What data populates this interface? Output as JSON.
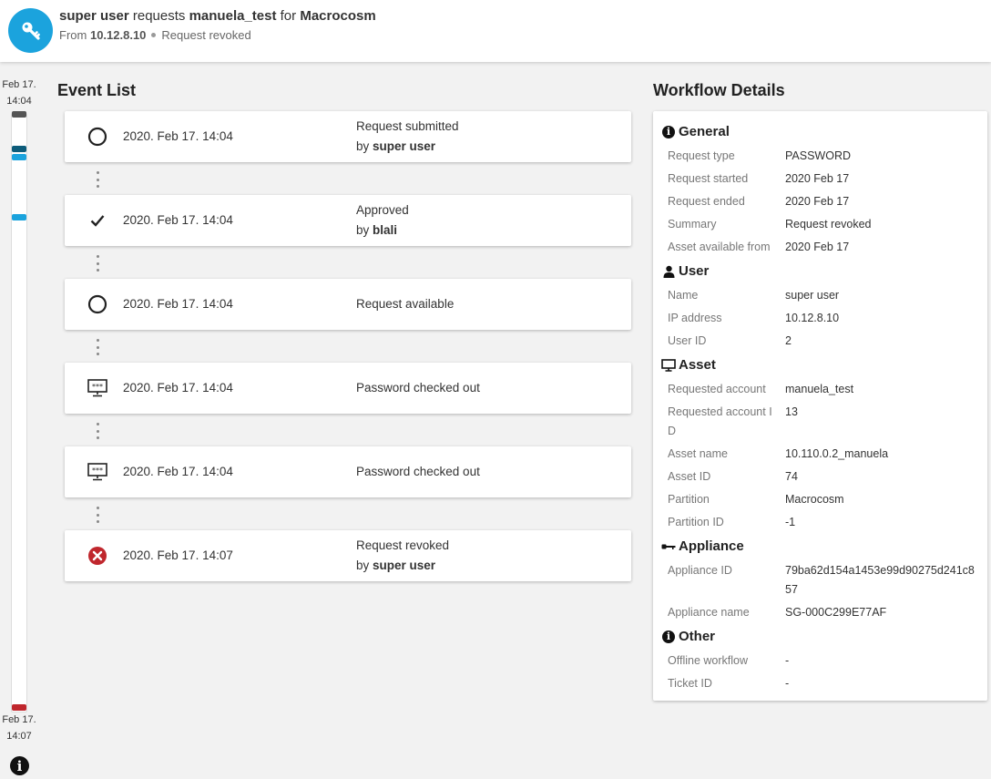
{
  "header": {
    "requester": "super user",
    "requests_word": "requests",
    "account": "manuela_test",
    "for_word": "for",
    "partition": "Macrocosm",
    "from_word": "From",
    "ip": "10.12.8.10",
    "status": "Request revoked",
    "accent_color": "#1ba3dd"
  },
  "timeline": {
    "start_date": "Feb 17.",
    "start_time": "14:04",
    "end_date": "Feb 17.",
    "end_time": "14:07",
    "marker_colors": [
      "#555555",
      "#0d5c7a",
      "#1ba3dd",
      "#1ba3dd",
      "#c0272d"
    ]
  },
  "event_list": {
    "title": "Event List",
    "events": [
      {
        "icon": "circle-icon",
        "time": "2020. Feb 17. 14:04",
        "text": "Request submitted",
        "by": "by",
        "actor": "super user"
      },
      {
        "icon": "checkmark-icon",
        "time": "2020. Feb 17. 14:04",
        "text": "Approved",
        "by": "by",
        "actor": "blali"
      },
      {
        "icon": "circle-icon",
        "time": "2020. Feb 17. 14:04",
        "text": "Request available",
        "by": "",
        "actor": ""
      },
      {
        "icon": "password-monitor-icon",
        "time": "2020. Feb 17. 14:04",
        "text": "Password checked out",
        "by": "",
        "actor": ""
      },
      {
        "icon": "password-monitor-icon",
        "time": "2020. Feb 17. 14:04",
        "text": "Password checked out",
        "by": "",
        "actor": ""
      },
      {
        "icon": "revoked-x-icon",
        "time": "2020. Feb 17. 14:07",
        "text": "Request revoked",
        "by": "by",
        "actor": "super user"
      }
    ]
  },
  "workflow": {
    "title": "Workflow Details",
    "groups": {
      "general": {
        "title": "General",
        "rows": [
          {
            "k": "Request type",
            "v": "PASSWORD"
          },
          {
            "k": "Request started",
            "v": "2020 Feb 17"
          },
          {
            "k": "Request ended",
            "v": "2020 Feb 17"
          },
          {
            "k": "Summary",
            "v": "Request revoked"
          },
          {
            "k": "Asset available from",
            "v": "2020 Feb 17"
          }
        ]
      },
      "user": {
        "title": "User",
        "rows": [
          {
            "k": "Name",
            "v": "super user"
          },
          {
            "k": "IP address",
            "v": "10.12.8.10"
          },
          {
            "k": "User ID",
            "v": "2"
          }
        ]
      },
      "asset": {
        "title": "Asset",
        "rows": [
          {
            "k": "Requested account",
            "v": "manuela_test"
          },
          {
            "k": "Requested account I",
            "k2": "D",
            "v": "13"
          },
          {
            "k": "Asset name",
            "v": "10.110.0.2_manuela"
          },
          {
            "k": "Asset ID",
            "v": "74"
          },
          {
            "k": "Partition",
            "v": "Macrocosm"
          },
          {
            "k": "Partition ID",
            "v": "-1"
          }
        ]
      },
      "appliance": {
        "title": "Appliance",
        "rows": [
          {
            "k": "Appliance ID",
            "v": "79ba62d154a1453e99d90275d241c8",
            "v2": "57"
          },
          {
            "k": "Appliance name",
            "v": "SG-000C299E77AF"
          }
        ]
      },
      "other": {
        "title": "Other",
        "rows": [
          {
            "k": "Offline workflow",
            "v": "-"
          },
          {
            "k": "Ticket ID",
            "v": "-"
          }
        ]
      }
    }
  }
}
